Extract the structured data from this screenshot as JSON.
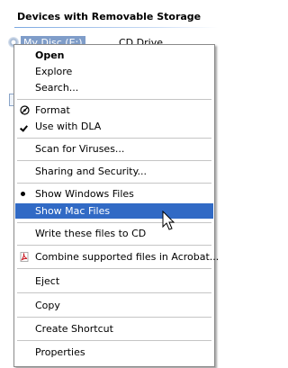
{
  "group": {
    "title": "Devices with Removable Storage"
  },
  "drive": {
    "name": "My Disc (E:)",
    "type": "CD Drive"
  },
  "menu": {
    "items": [
      {
        "label": "Open"
      },
      {
        "label": "Explore"
      },
      {
        "label": "Search..."
      },
      {
        "label": "Format",
        "icon": "format-icon"
      },
      {
        "label": "Use with DLA",
        "icon": "checkmark-icon"
      },
      {
        "label": "Scan for Viruses..."
      },
      {
        "label": "Sharing and Security..."
      },
      {
        "label": "Show Windows Files",
        "icon": "radio-bullet-icon"
      },
      {
        "label": "Show Mac Files"
      },
      {
        "label": "Write these files to CD"
      },
      {
        "label": "Combine supported files in Acrobat...",
        "icon": "acrobat-icon"
      },
      {
        "label": "Eject"
      },
      {
        "label": "Copy"
      },
      {
        "label": "Create Shortcut"
      },
      {
        "label": "Properties"
      }
    ]
  },
  "colors": {
    "highlight": "#316ac5",
    "selection": "#7f9dc9",
    "menu_border": "#8a8a8a"
  }
}
